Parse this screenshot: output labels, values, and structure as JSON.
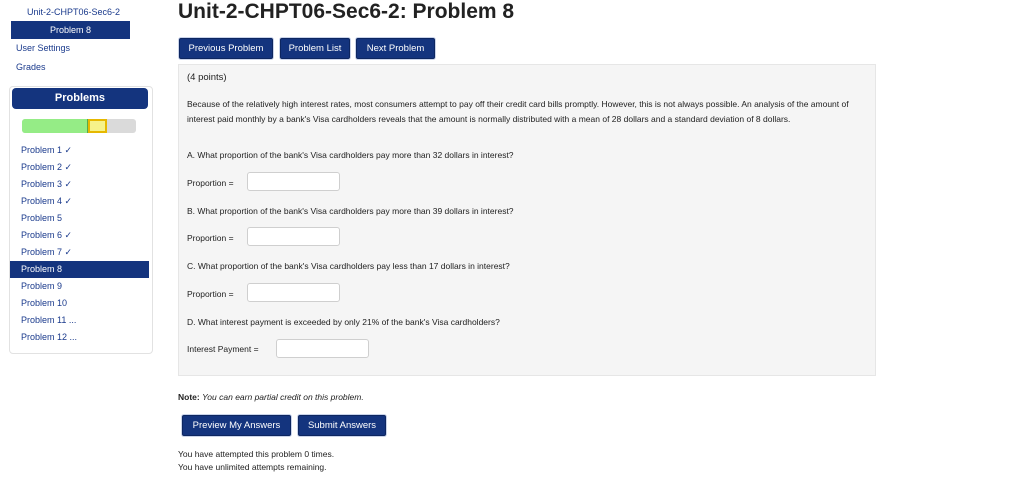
{
  "nav": {
    "crumb_set": "Unit-2-CHPT06-Sec6-2",
    "crumb_problem": "Problem 8",
    "user_settings": "User Settings",
    "grades": "Grades"
  },
  "problems_panel": {
    "header": "Problems",
    "progress": {
      "correct_fraction": 0.58,
      "current_fraction": 0.17
    },
    "items": [
      {
        "label": "Problem 1 ✓"
      },
      {
        "label": "Problem 2 ✓"
      },
      {
        "label": "Problem 3 ✓"
      },
      {
        "label": "Problem 4 ✓"
      },
      {
        "label": "Problem 5"
      },
      {
        "label": "Problem 6 ✓"
      },
      {
        "label": "Problem 7 ✓"
      },
      {
        "label": "Problem 8"
      },
      {
        "label": "Problem 9"
      },
      {
        "label": "Problem 10"
      },
      {
        "label": "Problem 11 ..."
      },
      {
        "label": "Problem 12 ..."
      }
    ]
  },
  "main": {
    "title": "Unit-2-CHPT06-Sec6-2: Problem 8",
    "buttons": {
      "previous": "Previous Problem",
      "list": "Problem List",
      "next": "Next Problem"
    },
    "points": "(4 points)",
    "statement": "Because of the relatively high interest rates, most consumers attempt to pay off their credit card bills promptly. However, this is not always possible. An analysis of the amount of interest paid monthly by a bank's Visa cardholders reveals that the amount is normally distributed with a mean of 28 dollars and a standard deviation of 8 dollars.",
    "questions": [
      {
        "text": "A. What proportion of the bank's Visa cardholders pay more than 32 dollars in interest?",
        "label": "Proportion =",
        "value": ""
      },
      {
        "text": "B. What proportion of the bank's Visa cardholders pay more than 39 dollars in interest?",
        "label": "Proportion =",
        "value": ""
      },
      {
        "text": "C. What proportion of the bank's Visa cardholders pay less than 17 dollars in interest?",
        "label": "Proportion =",
        "value": ""
      },
      {
        "text": "D. What interest payment is exceeded by only 21% of the bank's Visa cardholders?",
        "label": "Interest Payment =",
        "value": ""
      }
    ],
    "note_label": "Note:",
    "note_text": "You can earn partial credit on this problem.",
    "preview_button": "Preview My Answers",
    "submit_button": "Submit Answers",
    "attempted": "You have attempted this problem 0 times.",
    "remaining": "You have unlimited attempts remaining."
  },
  "colors": {
    "nav_blue": "#14347e",
    "progress_correct": "#95ec86",
    "progress_current": "#f6f28a",
    "progress_current_border": "#e6b800"
  }
}
